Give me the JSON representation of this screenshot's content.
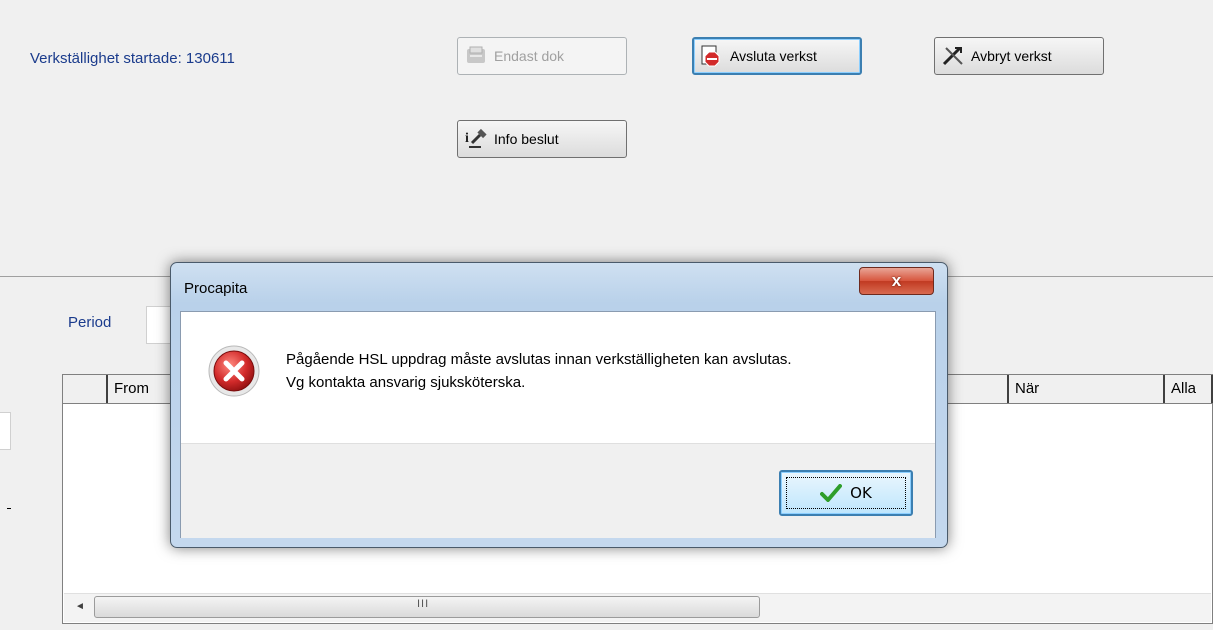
{
  "header": {
    "started_label": "Verkställighet startade: 130611"
  },
  "toolbar": {
    "endast_dok": "Endast dok",
    "avsluta_verkst": "Avsluta verkst",
    "avbryt_verkst": "Avbryt verkst",
    "info_beslut": "Info beslut"
  },
  "filter": {
    "period_label": "Period"
  },
  "grid": {
    "columns": [
      "From",
      "När",
      "Alla"
    ]
  },
  "scrollbar": {
    "left_arrow": "◄",
    "thumb_grip": "III"
  },
  "dialog": {
    "title": "Procapita",
    "close_label": "x",
    "message_line1": "Pågående HSL uppdrag måste avslutas innan verkställigheten kan avslutas.",
    "message_line2": "Vg kontakta ansvarig sjuksköterska.",
    "ok_label": "OK",
    "icon": "error-icon"
  },
  "colors": {
    "label_blue": "#1a3b8c",
    "error_red": "#d22a2a",
    "ok_check_green": "#2e9e2a",
    "focus_blue": "#3c7fb1"
  }
}
